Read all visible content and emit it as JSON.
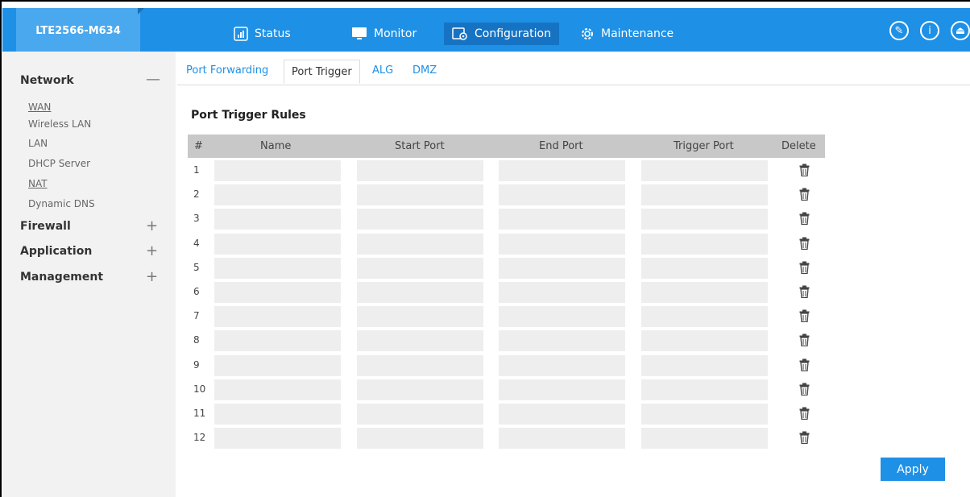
{
  "header": {
    "brand": "LTE2566-M634",
    "nav": [
      {
        "label": "Status",
        "icon": "status-icon"
      },
      {
        "label": "Monitor",
        "icon": "monitor-icon"
      },
      {
        "label": "Configuration",
        "icon": "configuration-icon"
      },
      {
        "label": "Maintenance",
        "icon": "gear-icon"
      }
    ],
    "active_nav": "Configuration",
    "tools": [
      {
        "icon": "wizard-icon",
        "glyph": "✎"
      },
      {
        "icon": "info-icon",
        "glyph": "i"
      },
      {
        "icon": "logout-icon",
        "glyph": "⏏"
      }
    ],
    "accent": "#1e90e6"
  },
  "sidebar": {
    "sections": [
      {
        "title": "Network",
        "toggle": "—",
        "items": [
          {
            "label": "WAN",
            "underline": true
          },
          {
            "label": "Wireless LAN",
            "underline": false
          },
          {
            "label": "LAN",
            "underline": false
          },
          {
            "label": "DHCP Server",
            "underline": false
          },
          {
            "label": "NAT",
            "underline": true
          },
          {
            "label": "Dynamic DNS",
            "underline": false
          }
        ]
      },
      {
        "title": "Firewall",
        "toggle": "+"
      },
      {
        "title": "Application",
        "toggle": "+"
      },
      {
        "title": "Management",
        "toggle": "+"
      }
    ]
  },
  "tabs": [
    {
      "label": "Port Forwarding",
      "active": false
    },
    {
      "label": "Port Trigger",
      "active": true
    },
    {
      "label": "ALG",
      "active": false
    },
    {
      "label": "DMZ",
      "active": false
    }
  ],
  "section_title": "Port Trigger Rules",
  "table": {
    "headers": [
      "#",
      "Name",
      "Start Port",
      "End Port",
      "Trigger Port",
      "Delete"
    ],
    "rows": [
      {
        "num": "1",
        "name": "",
        "start_port": "",
        "end_port": "",
        "trigger_port": ""
      },
      {
        "num": "2",
        "name": "",
        "start_port": "",
        "end_port": "",
        "trigger_port": ""
      },
      {
        "num": "3",
        "name": "",
        "start_port": "",
        "end_port": "",
        "trigger_port": ""
      },
      {
        "num": "4",
        "name": "",
        "start_port": "",
        "end_port": "",
        "trigger_port": ""
      },
      {
        "num": "5",
        "name": "",
        "start_port": "",
        "end_port": "",
        "trigger_port": ""
      },
      {
        "num": "6",
        "name": "",
        "start_port": "",
        "end_port": "",
        "trigger_port": ""
      },
      {
        "num": "7",
        "name": "",
        "start_port": "",
        "end_port": "",
        "trigger_port": ""
      },
      {
        "num": "8",
        "name": "",
        "start_port": "",
        "end_port": "",
        "trigger_port": ""
      },
      {
        "num": "9",
        "name": "",
        "start_port": "",
        "end_port": "",
        "trigger_port": ""
      },
      {
        "num": "10",
        "name": "",
        "start_port": "",
        "end_port": "",
        "trigger_port": ""
      },
      {
        "num": "11",
        "name": "",
        "start_port": "",
        "end_port": "",
        "trigger_port": ""
      },
      {
        "num": "12",
        "name": "",
        "start_port": "",
        "end_port": "",
        "trigger_port": ""
      }
    ],
    "delete_icon": "trash-icon"
  },
  "apply_label": "Apply"
}
